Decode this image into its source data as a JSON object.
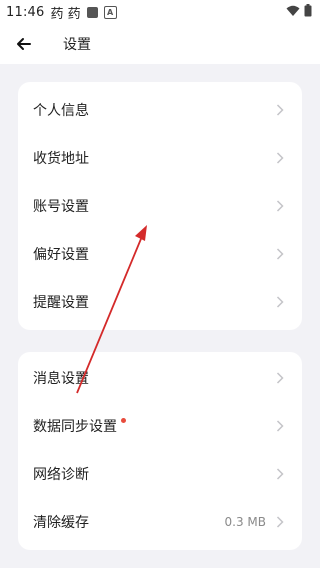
{
  "status_bar": {
    "time": "11:46",
    "app_icons_text": "药 药"
  },
  "header": {
    "title": "设置"
  },
  "group1": {
    "items": [
      {
        "label": "个人信息"
      },
      {
        "label": "收货地址"
      },
      {
        "label": "账号设置"
      },
      {
        "label": "偏好设置"
      },
      {
        "label": "提醒设置"
      }
    ]
  },
  "group2": {
    "items": [
      {
        "label": "消息设置"
      },
      {
        "label": "数据同步设置"
      },
      {
        "label": "网络诊断"
      },
      {
        "label": "清除缓存",
        "value": "0.3 MB"
      }
    ]
  },
  "colors": {
    "background": "#f2f2f6",
    "card": "#ffffff",
    "annotation_arrow": "#d42a2a",
    "badge_dot": "#e84b3c"
  },
  "icons": [
    "back-arrow-icon",
    "chevron-right-icon",
    "wifi-icon",
    "battery-icon"
  ]
}
